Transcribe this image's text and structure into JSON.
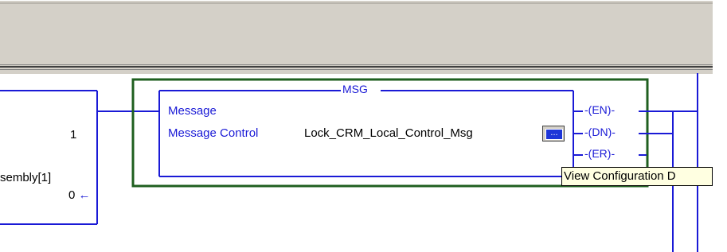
{
  "instruction": {
    "title": "MSG",
    "message_label": "Message",
    "message_control_label": "Message Control",
    "message_control_value": "Lock_CRM_Local_Control_Msg",
    "config_button_label": "...",
    "outputs": [
      "EN",
      "DN",
      "ER"
    ]
  },
  "left_block": {
    "value_1": "1",
    "assembly_label": "sembly[1]",
    "value_0": "0"
  },
  "tooltip": {
    "text": "View Configuration D"
  },
  "colors": {
    "rung_wire": "#1a1ad6",
    "instruction_text": "#1a1ad6",
    "selection_box": "#1f5f1f",
    "toolbar_bg": "#d4d0c8",
    "tooltip_bg": "#ffffe1"
  }
}
